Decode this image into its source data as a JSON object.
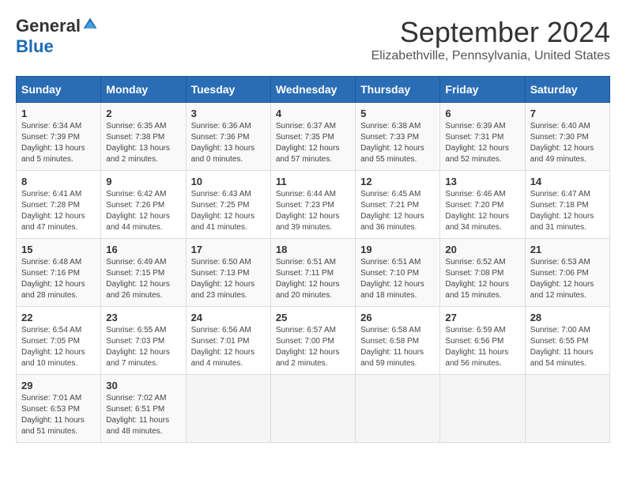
{
  "logo": {
    "general": "General",
    "blue": "Blue"
  },
  "title": "September 2024",
  "subtitle": "Elizabethville, Pennsylvania, United States",
  "headers": [
    "Sunday",
    "Monday",
    "Tuesday",
    "Wednesday",
    "Thursday",
    "Friday",
    "Saturday"
  ],
  "weeks": [
    [
      {
        "day": "1",
        "sunrise": "Sunrise: 6:34 AM",
        "sunset": "Sunset: 7:39 PM",
        "daylight": "Daylight: 13 hours and 5 minutes."
      },
      {
        "day": "2",
        "sunrise": "Sunrise: 6:35 AM",
        "sunset": "Sunset: 7:38 PM",
        "daylight": "Daylight: 13 hours and 2 minutes."
      },
      {
        "day": "3",
        "sunrise": "Sunrise: 6:36 AM",
        "sunset": "Sunset: 7:36 PM",
        "daylight": "Daylight: 13 hours and 0 minutes."
      },
      {
        "day": "4",
        "sunrise": "Sunrise: 6:37 AM",
        "sunset": "Sunset: 7:35 PM",
        "daylight": "Daylight: 12 hours and 57 minutes."
      },
      {
        "day": "5",
        "sunrise": "Sunrise: 6:38 AM",
        "sunset": "Sunset: 7:33 PM",
        "daylight": "Daylight: 12 hours and 55 minutes."
      },
      {
        "day": "6",
        "sunrise": "Sunrise: 6:39 AM",
        "sunset": "Sunset: 7:31 PM",
        "daylight": "Daylight: 12 hours and 52 minutes."
      },
      {
        "day": "7",
        "sunrise": "Sunrise: 6:40 AM",
        "sunset": "Sunset: 7:30 PM",
        "daylight": "Daylight: 12 hours and 49 minutes."
      }
    ],
    [
      {
        "day": "8",
        "sunrise": "Sunrise: 6:41 AM",
        "sunset": "Sunset: 7:28 PM",
        "daylight": "Daylight: 12 hours and 47 minutes."
      },
      {
        "day": "9",
        "sunrise": "Sunrise: 6:42 AM",
        "sunset": "Sunset: 7:26 PM",
        "daylight": "Daylight: 12 hours and 44 minutes."
      },
      {
        "day": "10",
        "sunrise": "Sunrise: 6:43 AM",
        "sunset": "Sunset: 7:25 PM",
        "daylight": "Daylight: 12 hours and 41 minutes."
      },
      {
        "day": "11",
        "sunrise": "Sunrise: 6:44 AM",
        "sunset": "Sunset: 7:23 PM",
        "daylight": "Daylight: 12 hours and 39 minutes."
      },
      {
        "day": "12",
        "sunrise": "Sunrise: 6:45 AM",
        "sunset": "Sunset: 7:21 PM",
        "daylight": "Daylight: 12 hours and 36 minutes."
      },
      {
        "day": "13",
        "sunrise": "Sunrise: 6:46 AM",
        "sunset": "Sunset: 7:20 PM",
        "daylight": "Daylight: 12 hours and 34 minutes."
      },
      {
        "day": "14",
        "sunrise": "Sunrise: 6:47 AM",
        "sunset": "Sunset: 7:18 PM",
        "daylight": "Daylight: 12 hours and 31 minutes."
      }
    ],
    [
      {
        "day": "15",
        "sunrise": "Sunrise: 6:48 AM",
        "sunset": "Sunset: 7:16 PM",
        "daylight": "Daylight: 12 hours and 28 minutes."
      },
      {
        "day": "16",
        "sunrise": "Sunrise: 6:49 AM",
        "sunset": "Sunset: 7:15 PM",
        "daylight": "Daylight: 12 hours and 26 minutes."
      },
      {
        "day": "17",
        "sunrise": "Sunrise: 6:50 AM",
        "sunset": "Sunset: 7:13 PM",
        "daylight": "Daylight: 12 hours and 23 minutes."
      },
      {
        "day": "18",
        "sunrise": "Sunrise: 6:51 AM",
        "sunset": "Sunset: 7:11 PM",
        "daylight": "Daylight: 12 hours and 20 minutes."
      },
      {
        "day": "19",
        "sunrise": "Sunrise: 6:51 AM",
        "sunset": "Sunset: 7:10 PM",
        "daylight": "Daylight: 12 hours and 18 minutes."
      },
      {
        "day": "20",
        "sunrise": "Sunrise: 6:52 AM",
        "sunset": "Sunset: 7:08 PM",
        "daylight": "Daylight: 12 hours and 15 minutes."
      },
      {
        "day": "21",
        "sunrise": "Sunrise: 6:53 AM",
        "sunset": "Sunset: 7:06 PM",
        "daylight": "Daylight: 12 hours and 12 minutes."
      }
    ],
    [
      {
        "day": "22",
        "sunrise": "Sunrise: 6:54 AM",
        "sunset": "Sunset: 7:05 PM",
        "daylight": "Daylight: 12 hours and 10 minutes."
      },
      {
        "day": "23",
        "sunrise": "Sunrise: 6:55 AM",
        "sunset": "Sunset: 7:03 PM",
        "daylight": "Daylight: 12 hours and 7 minutes."
      },
      {
        "day": "24",
        "sunrise": "Sunrise: 6:56 AM",
        "sunset": "Sunset: 7:01 PM",
        "daylight": "Daylight: 12 hours and 4 minutes."
      },
      {
        "day": "25",
        "sunrise": "Sunrise: 6:57 AM",
        "sunset": "Sunset: 7:00 PM",
        "daylight": "Daylight: 12 hours and 2 minutes."
      },
      {
        "day": "26",
        "sunrise": "Sunrise: 6:58 AM",
        "sunset": "Sunset: 6:58 PM",
        "daylight": "Daylight: 11 hours and 59 minutes."
      },
      {
        "day": "27",
        "sunrise": "Sunrise: 6:59 AM",
        "sunset": "Sunset: 6:56 PM",
        "daylight": "Daylight: 11 hours and 56 minutes."
      },
      {
        "day": "28",
        "sunrise": "Sunrise: 7:00 AM",
        "sunset": "Sunset: 6:55 PM",
        "daylight": "Daylight: 11 hours and 54 minutes."
      }
    ],
    [
      {
        "day": "29",
        "sunrise": "Sunrise: 7:01 AM",
        "sunset": "Sunset: 6:53 PM",
        "daylight": "Daylight: 11 hours and 51 minutes."
      },
      {
        "day": "30",
        "sunrise": "Sunrise: 7:02 AM",
        "sunset": "Sunset: 6:51 PM",
        "daylight": "Daylight: 11 hours and 48 minutes."
      },
      null,
      null,
      null,
      null,
      null
    ]
  ]
}
